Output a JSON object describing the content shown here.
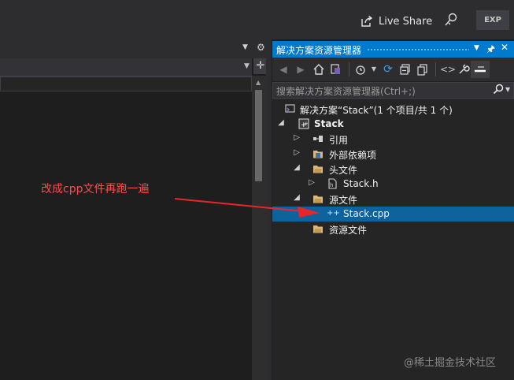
{
  "topbar": {
    "live_share": "Live Share",
    "exp_badge": "EXP"
  },
  "solution_explorer": {
    "title": "解决方案资源管理器",
    "search_placeholder": "搜索解决方案资源管理器(Ctrl+;)",
    "selected_color": "#0e639c",
    "accent_color": "#007acc",
    "tree": [
      {
        "label": "解决方案“Stack”(1 个项目/共 1 个)",
        "icon": "solution-icon",
        "expander": "none",
        "bold": false
      },
      {
        "label": "Stack",
        "icon": "project-icon",
        "expander": "expanded",
        "bold": true
      },
      {
        "label": "引用",
        "icon": "references-icon",
        "expander": "collapsed",
        "bold": false
      },
      {
        "label": "外部依赖项",
        "icon": "external-deps-icon",
        "expander": "collapsed",
        "bold": false
      },
      {
        "label": "头文件",
        "icon": "folder-icon",
        "expander": "expanded",
        "bold": false
      },
      {
        "label": "Stack.h",
        "icon": "header-file-icon",
        "expander": "collapsed",
        "bold": false
      },
      {
        "label": "源文件",
        "icon": "folder-icon",
        "expander": "expanded",
        "bold": false
      },
      {
        "label": "Stack.cpp",
        "icon": "cpp-file-icon",
        "expander": "none",
        "bold": false,
        "selected": true
      },
      {
        "label": "资源文件",
        "icon": "folder-icon",
        "expander": "none",
        "bold": false
      }
    ]
  },
  "annotation": {
    "text": "改成cpp文件再跑一遍",
    "color": "#ff4d4d"
  },
  "watermark": "@稀土掘金技术社区"
}
